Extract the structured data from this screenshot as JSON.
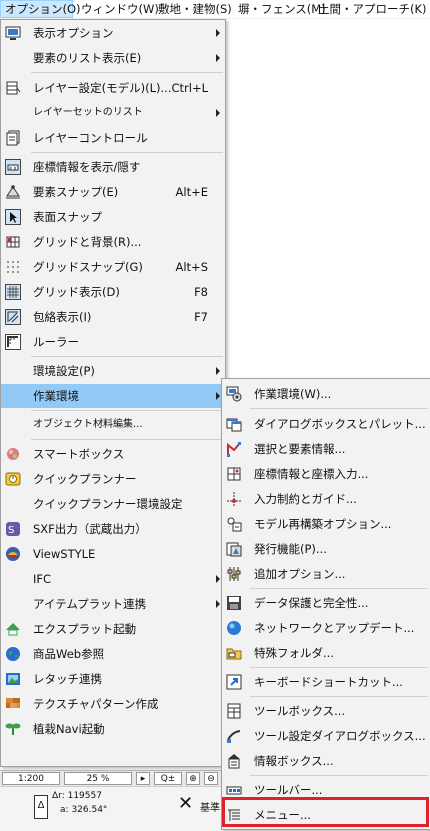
{
  "menubar": {
    "items": [
      {
        "label": "オプション(O)"
      },
      {
        "label": "ウィンドウ(W)"
      },
      {
        "label": "敷地・建物(S)"
      },
      {
        "label": "塀・フェンス(M)"
      },
      {
        "label": "土間・アプローチ(K)"
      }
    ]
  },
  "options_menu": {
    "items": [
      {
        "label": "表示オプション",
        "icon": "display-options-icon",
        "submenu": true
      },
      {
        "label": "要素のリスト表示(E)",
        "submenu": true
      },
      {
        "label": "レイヤー設定(モデル)(L)...",
        "shortcut": "Ctrl+L",
        "icon": "layer-settings-icon"
      },
      {
        "label": "レイヤーセットのリスト",
        "submenu": true
      },
      {
        "label": "レイヤーコントロール",
        "icon": "layer-control-icon"
      },
      {
        "label": "座標情報を表示/隠す",
        "icon": "coordinate-info-icon"
      },
      {
        "label": "要素スナップ(E)",
        "shortcut": "Alt+E",
        "icon": "element-snap-icon"
      },
      {
        "label": "表面スナップ",
        "icon": "surface-snap-icon"
      },
      {
        "label": "グリッドと背景(R)...",
        "icon": "grid-background-icon"
      },
      {
        "label": "グリッドスナップ(G)",
        "shortcut": "Alt+S",
        "icon": "grid-snap-icon"
      },
      {
        "label": "グリッド表示(D)",
        "shortcut": "F8",
        "icon": "grid-display-icon"
      },
      {
        "label": "包絡表示(I)",
        "shortcut": "F7",
        "icon": "envelope-display-icon"
      },
      {
        "label": "ルーラー",
        "icon": "ruler-icon"
      },
      {
        "label": "環境設定(P)",
        "submenu": true
      },
      {
        "label": "作業環境",
        "submenu": true,
        "highlighted": true
      },
      {
        "label": "オブジェクト材料編集..."
      },
      {
        "label": "スマートボックス",
        "icon": "smartbox-icon"
      },
      {
        "label": "クイックプランナー",
        "icon": "quick-planner-icon"
      },
      {
        "label": "クイックプランナー環境設定"
      },
      {
        "label": "SXF出力（武蔵出力）",
        "icon": "sxf-output-icon"
      },
      {
        "label": "ViewSTYLE",
        "icon": "viewstyle-icon"
      },
      {
        "label": "IFC",
        "submenu": true
      },
      {
        "label": "アイテムプラット連携",
        "submenu": true
      },
      {
        "label": "エクスプラット起動",
        "icon": "explat-icon"
      },
      {
        "label": "商品Web参照",
        "icon": "globe-icon"
      },
      {
        "label": "レタッチ連携",
        "icon": "retouch-icon"
      },
      {
        "label": "テクスチャパターン作成",
        "icon": "texture-pattern-icon"
      },
      {
        "label": "植栽Navi起動",
        "icon": "plant-navi-icon"
      }
    ]
  },
  "work_env_submenu": {
    "items": [
      {
        "label": "作業環境(W)...",
        "icon": "work-environment-icon"
      },
      {
        "label": "ダイアログボックスとパレット...",
        "icon": "dialog-palette-icon"
      },
      {
        "label": "選択と要素情報...",
        "icon": "selection-info-icon"
      },
      {
        "label": "座標情報と座標入力...",
        "icon": "coordinate-input-icon"
      },
      {
        "label": "入力制約とガイド...",
        "icon": "input-constraint-icon"
      },
      {
        "label": "モデル再構築オプション...",
        "icon": "model-rebuild-icon"
      },
      {
        "label": "発行機能(P)...",
        "icon": "publish-icon"
      },
      {
        "label": "追加オプション...",
        "icon": "more-options-icon"
      },
      {
        "label": "データ保護と完全性...",
        "icon": "data-safety-icon"
      },
      {
        "label": "ネットワークとアップデート...",
        "icon": "network-update-icon"
      },
      {
        "label": "特殊フォルダ...",
        "icon": "special-folder-icon"
      },
      {
        "label": "キーボードショートカット...",
        "icon": "keyboard-shortcut-icon"
      },
      {
        "label": "ツールボックス...",
        "icon": "toolbox-icon"
      },
      {
        "label": "ツール設定ダイアログボックス...",
        "icon": "tool-settings-icon"
      },
      {
        "label": "情報ボックス...",
        "icon": "info-box-icon"
      },
      {
        "label": "ツールバー...",
        "icon": "toolbar-icon"
      },
      {
        "label": "メニュー...",
        "icon": "menu-icon",
        "highlighted": true
      }
    ]
  },
  "status": {
    "scale": "1:200",
    "zoom": "25 %",
    "dr_label": "Δr:",
    "dr_value": "119557",
    "angle_label": "a:",
    "angle_value": "326.54°",
    "partial_label": "基準"
  },
  "colors": {
    "highlight": "#91c9f7",
    "menubar_active": "#cce8ff",
    "red_box": "#e0202a",
    "menu_bg": "#f2f2f2"
  }
}
